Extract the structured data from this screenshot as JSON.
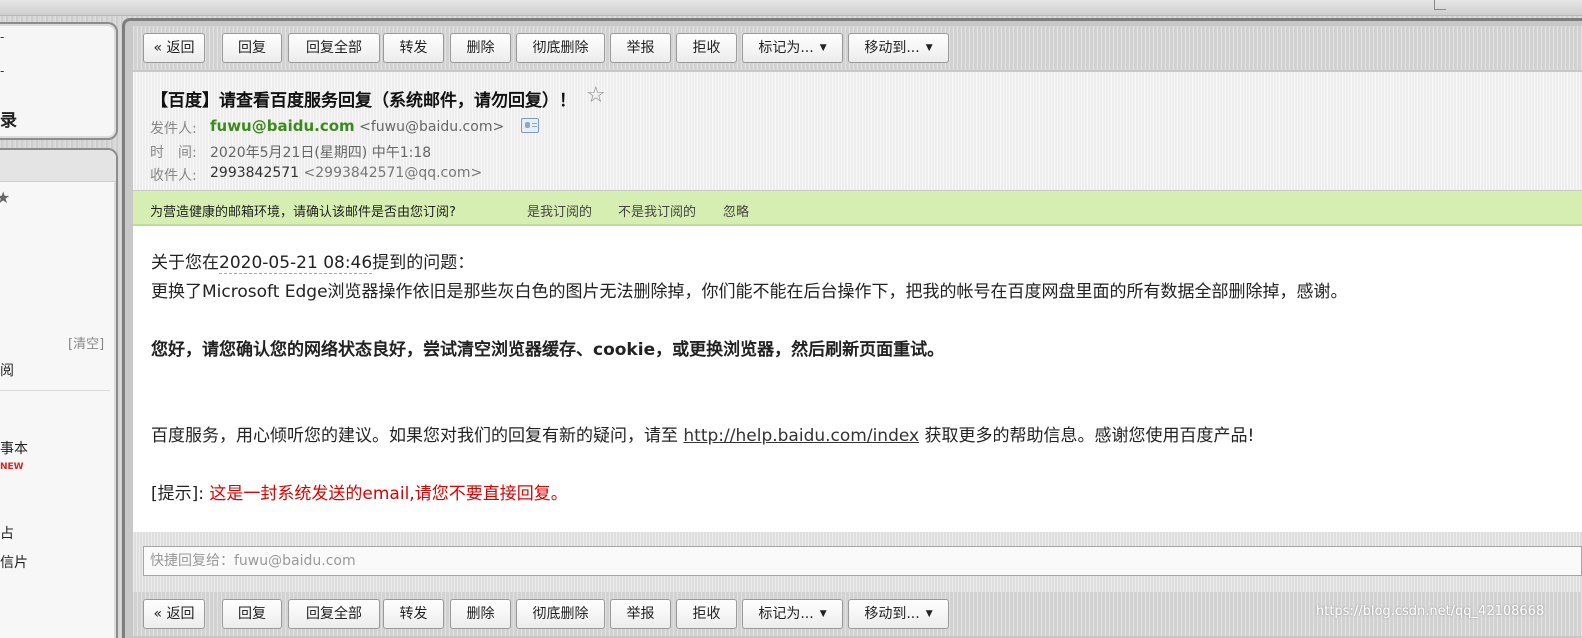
{
  "toolbar": {
    "back": "« 返回",
    "reply": "回复",
    "reply_all": "回复全部",
    "forward": "转发",
    "delete": "删除",
    "delete_perm": "彻底删除",
    "report": "举报",
    "reject": "拒收",
    "mark_as": "标记为...",
    "move_to": "移动到..."
  },
  "sidebar": {
    "box1_tick1": "-",
    "box1_tick2": "-",
    "box1_label": "录",
    "clear_label": "[清空]",
    "paren": ")",
    "subscribe_label": "阅",
    "memo_label": "事本",
    "new_badge": "NEW",
    "site_label": "占",
    "postcard_label": "信片"
  },
  "email": {
    "subject": "【百度】请查看百度服务回复（系统邮件，请勿回复）！",
    "sender_label": "发件人:",
    "sender_name": "fuwu@baidu.com",
    "sender_addr": "<fuwu@baidu.com>",
    "time_label": "时　间:",
    "time_value": "2020年5月21日(星期四) 中午1:18",
    "recipient_label": "收件人:",
    "recipient_name": "2993842571",
    "recipient_addr": "<2993842571@qq.com>"
  },
  "notice": {
    "text": "为营造健康的邮箱环境，请确认该邮件是否由您订阅?",
    "subscribed": "是我订阅的",
    "not_subscribed": "不是我订阅的",
    "ignore": "忽略"
  },
  "body": {
    "q_prefix": "关于您在",
    "q_date": "2020-05-21 08:46",
    "q_suffix": "提到的问题：",
    "question": "更换了Microsoft Edge浏览器操作依旧是那些灰白色的图片无法删除掉，你们能不能在后台操作下，把我的帐号在百度网盘里面的所有数据全部删除掉，感谢。",
    "answer": "您好，请您确认您的网络状态良好，尝试清空浏览器缓存、cookie，或更换浏览器，然后刷新页面重试。",
    "service_pre": "百度服务，用心倾听您的建议。如果您对我们的回复有新的疑问，请至 ",
    "service_link": "http://help.baidu.com/index",
    "service_post": " 获取更多的帮助信息。感谢您使用百度产品!",
    "tip_label": "[提示]: ",
    "tip_text": "这是一封系统发送的email,请您不要直接回复。"
  },
  "quick_reply": {
    "placeholder": "快捷回复给：fuwu@baidu.com"
  },
  "watermark": "https://blog.csdn.net/qq_42108668"
}
